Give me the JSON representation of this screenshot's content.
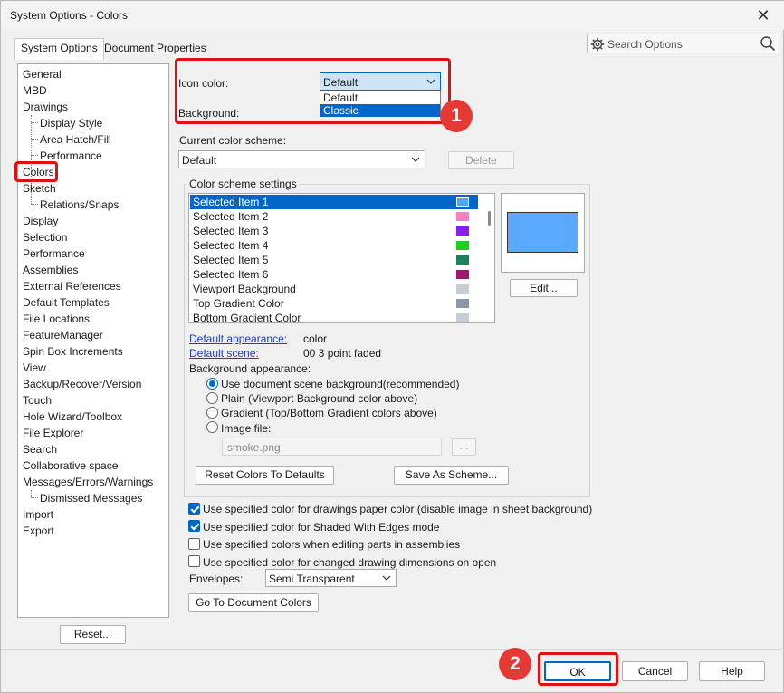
{
  "window": {
    "title": "System Options - Colors",
    "close_glyph": "✕"
  },
  "tabs": [
    {
      "label": "System Options"
    },
    {
      "label": "Document Properties"
    }
  ],
  "search": {
    "placeholder": "Search Options",
    "icon": "gear-icon"
  },
  "tree": {
    "items": [
      "General",
      "MBD",
      "Drawings",
      "Display Style",
      "Area Hatch/Fill",
      "Performance",
      "Colors",
      "Sketch",
      "Relations/Snaps",
      "Display",
      "Selection",
      "Performance",
      "Assemblies",
      "External References",
      "Default Templates",
      "File Locations",
      "FeatureManager",
      "Spin Box Increments",
      "View",
      "Backup/Recover/Version",
      "Touch",
      "Hole Wizard/Toolbox",
      "File Explorer",
      "Search",
      "Collaborative space",
      "Messages/Errors/Warnings",
      "Dismissed Messages",
      "Import",
      "Export"
    ],
    "selected": "Colors"
  },
  "reset_button": "Reset...",
  "icon_color": {
    "label": "Icon color:",
    "value": "Default",
    "options": [
      "Default",
      "Classic"
    ],
    "highlighted": "Classic"
  },
  "background_label": "Background:",
  "scheme": {
    "label": "Current color scheme:",
    "value": "Default",
    "delete_label": "Delete"
  },
  "settings": {
    "group_label": "Color scheme settings",
    "items": [
      {
        "label": "Selected Item 1",
        "color": "#4da6ff"
      },
      {
        "label": "Selected Item 2",
        "color": "#ff7fbf"
      },
      {
        "label": "Selected Item 3",
        "color": "#8c1aff"
      },
      {
        "label": "Selected Item 4",
        "color": "#1ad11a"
      },
      {
        "label": "Selected Item 5",
        "color": "#1a8060"
      },
      {
        "label": "Selected Item 6",
        "color": "#9e1a6e"
      },
      {
        "label": "Viewport Background",
        "color": "#c8cdd4"
      },
      {
        "label": "Top Gradient Color",
        "color": "#8c97a6"
      },
      {
        "label": "Bottom Gradient Color",
        "color": "#c8cdd4"
      }
    ],
    "selected_index": 0,
    "preview_color": "#5aa8ff",
    "edit_label": "Edit...",
    "default_appearance_label": "Default appearance:",
    "default_appearance_value": "color",
    "default_scene_label": "Default scene:",
    "default_scene_value": "00 3 point faded",
    "bg_appearance_label": "Background appearance:",
    "bg_options": [
      "Use document scene background(recommended)",
      "Plain (Viewport Background color above)",
      "Gradient (Top/Bottom Gradient colors above)",
      "Image file:"
    ],
    "bg_selected": 0,
    "image_file": "smoke.png",
    "browse_label": "...",
    "reset_colors_label": "Reset Colors To Defaults",
    "save_scheme_label": "Save As Scheme..."
  },
  "checks": [
    {
      "label": "Use specified color for drawings paper color (disable image in sheet background)",
      "checked": true
    },
    {
      "label": "Use specified color for Shaded With Edges mode",
      "checked": true
    },
    {
      "label": "Use specified colors when editing parts in assemblies",
      "checked": false
    },
    {
      "label": "Use specified color for changed drawing dimensions on open",
      "checked": false
    }
  ],
  "envelopes": {
    "label": "Envelopes:",
    "value": "Semi Transparent"
  },
  "goto_doc_colors": "Go To Document Colors",
  "footer": {
    "ok": "OK",
    "cancel": "Cancel",
    "help": "Help"
  },
  "annotations": {
    "badge1": "1",
    "badge2": "2",
    "accent": "#e01010"
  }
}
